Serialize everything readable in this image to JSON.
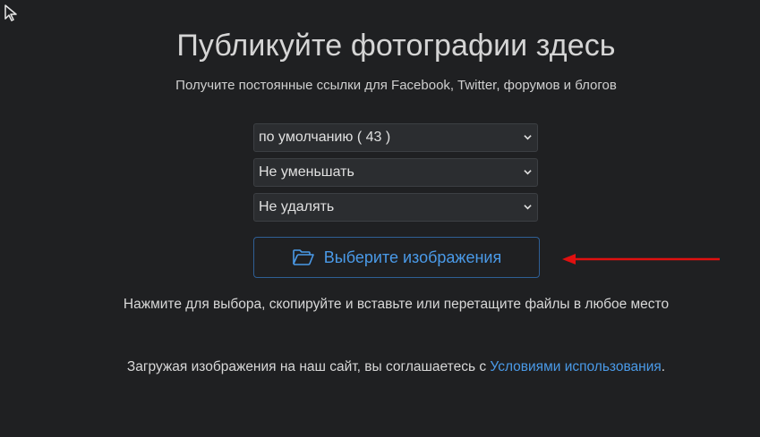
{
  "header": {
    "title": "Публикуйте фотографии здесь",
    "subtitle": "Получите постоянные ссылки для Facebook, Twitter, форумов и блогов"
  },
  "options": {
    "album": {
      "selected": "по умолчанию ( 43 )"
    },
    "resize": {
      "selected": "Не уменьшать"
    },
    "expire": {
      "selected": "Не удалять"
    }
  },
  "upload": {
    "button_label": "Выберите изображения",
    "icon": "folder-open-icon"
  },
  "hint": "Нажмите для выбора, скопируйте и вставьте или перетащите файлы в любое место",
  "terms": {
    "prefix": "Загружая изображения на наш сайт, вы соглашаетесь с ",
    "link_label": "Условиями использования",
    "suffix": "."
  },
  "colors": {
    "background": "#1f2022",
    "accent": "#4a9ae8",
    "arrow": "#e01010"
  }
}
